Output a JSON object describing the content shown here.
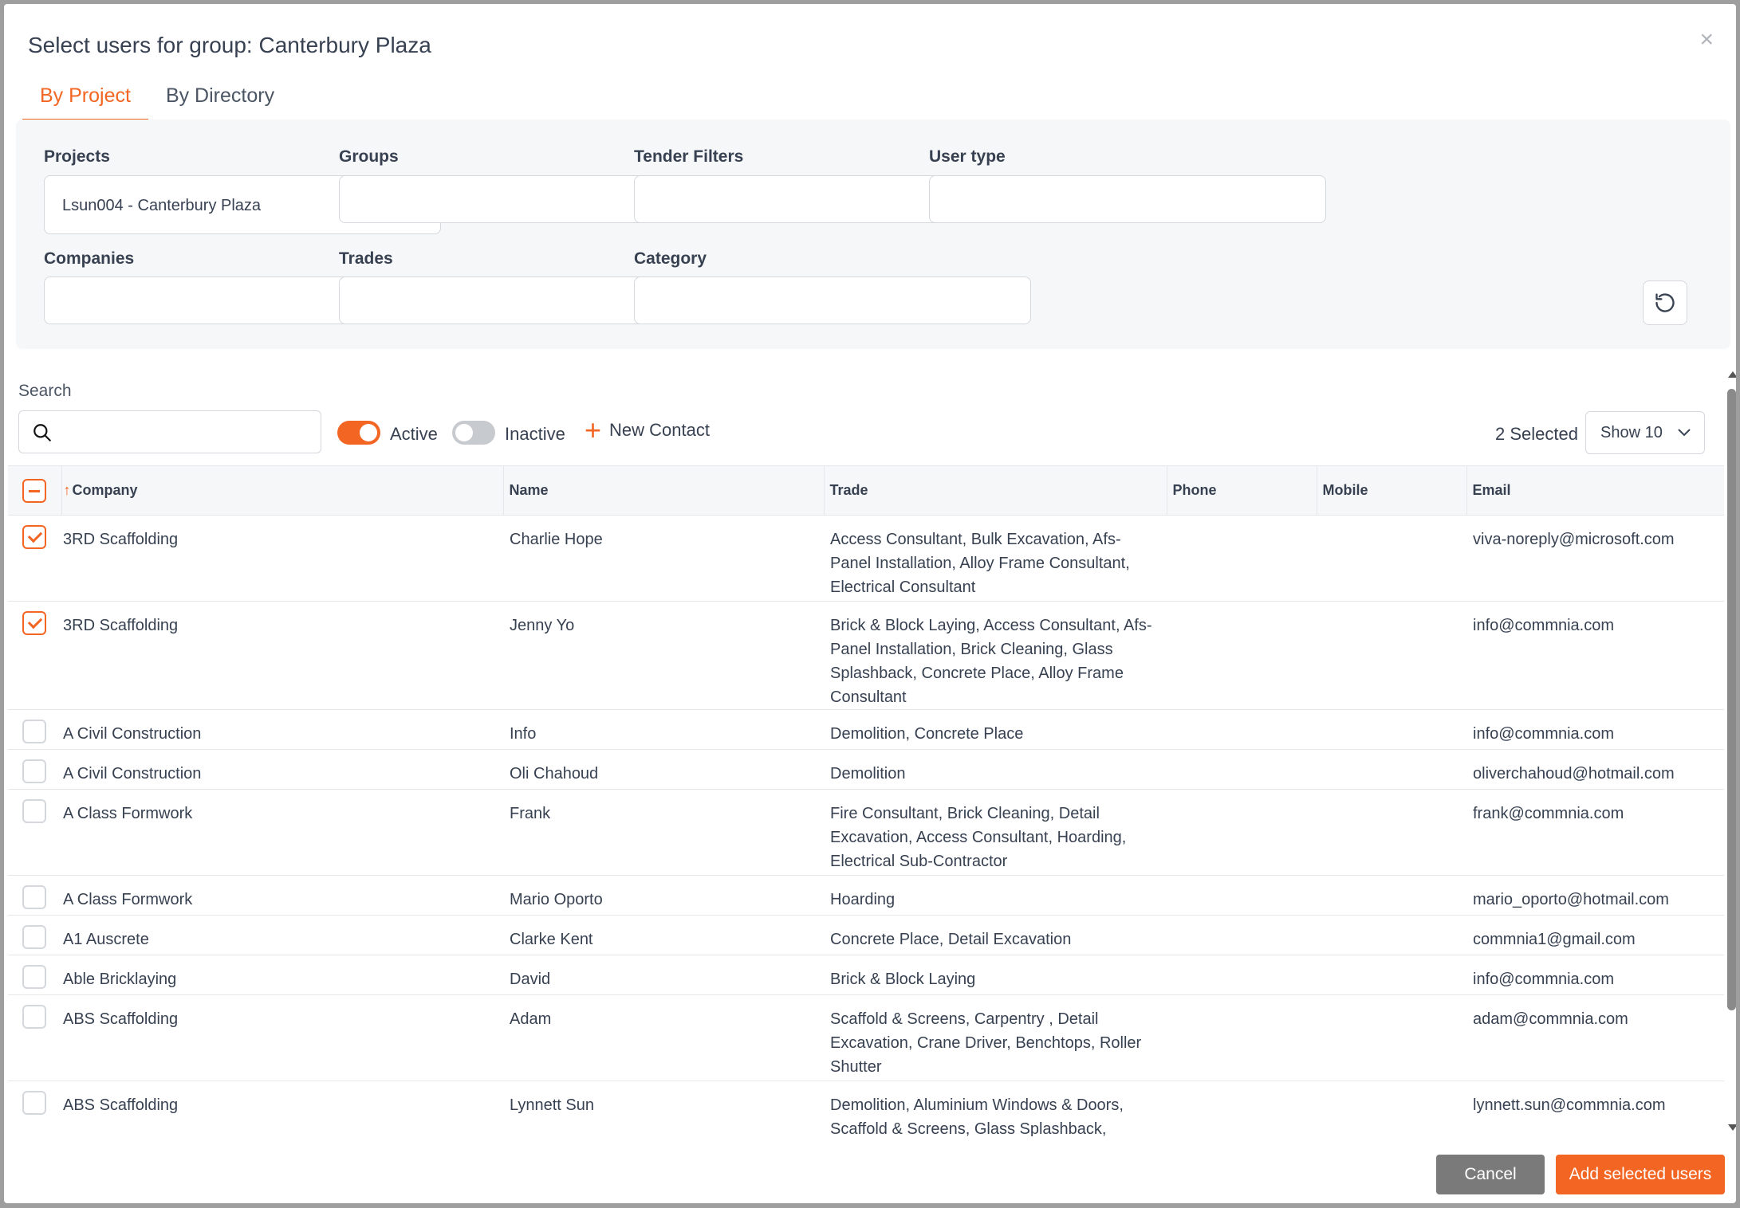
{
  "dialog": {
    "title": "Select users for group: Canterbury Plaza",
    "close_glyph": "×"
  },
  "tabs": [
    {
      "label": "By Project",
      "active": true
    },
    {
      "label": "By Directory",
      "active": false
    }
  ],
  "filters": {
    "projects": {
      "label": "Projects",
      "value": "Lsun004 - Canterbury Plaza"
    },
    "groups": {
      "label": "Groups",
      "value": ""
    },
    "tender_filters": {
      "label": "Tender Filters",
      "value": ""
    },
    "user_type": {
      "label": "User type",
      "value": ""
    },
    "companies": {
      "label": "Companies",
      "value": ""
    },
    "trades": {
      "label": "Trades",
      "value": ""
    },
    "category": {
      "label": "Category",
      "value": ""
    }
  },
  "toolbar": {
    "search_label": "Search",
    "search_value": "",
    "active_label": "Active",
    "active_on": true,
    "inactive_label": "Inactive",
    "inactive_on": false,
    "new_contact_label": "New Contact",
    "selected_count": "2 Selected",
    "show_value": "Show 10"
  },
  "table": {
    "columns": {
      "company": "Company",
      "name": "Name",
      "trade": "Trade",
      "phone": "Phone",
      "mobile": "Mobile",
      "email": "Email"
    },
    "sort_arrow": "↑",
    "rows": [
      {
        "checked": true,
        "company": "3RD Scaffolding",
        "name": "Charlie Hope",
        "trade": "Access Consultant, Bulk Excavation, Afs-Panel Installation, Alloy Frame Consultant, Electrical Consultant",
        "phone": "",
        "mobile": "",
        "email": "viva-noreply@microsoft.com"
      },
      {
        "checked": true,
        "company": "3RD Scaffolding",
        "name": "Jenny Yo",
        "trade": "Brick & Block Laying, Access Consultant, Afs-Panel Installation, Brick Cleaning, Glass Splashback, Concrete Place, Alloy Frame Consultant",
        "phone": "",
        "mobile": "",
        "email": "info@commnia.com"
      },
      {
        "checked": false,
        "company": "A Civil Construction",
        "name": "Info",
        "trade": "Demolition, Concrete Place",
        "phone": "",
        "mobile": "",
        "email": "info@commnia.com"
      },
      {
        "checked": false,
        "company": "A Civil Construction",
        "name": "Oli Chahoud",
        "trade": "Demolition",
        "phone": "",
        "mobile": "",
        "email": "oliverchahoud@hotmail.com"
      },
      {
        "checked": false,
        "company": "A Class Formwork",
        "name": "Frank",
        "trade": "Fire Consultant, Brick Cleaning, Detail Excavation, Access Consultant, Hoarding, Electrical Sub-Contractor",
        "phone": "",
        "mobile": "",
        "email": "frank@commnia.com"
      },
      {
        "checked": false,
        "company": "A Class Formwork",
        "name": "Mario Oporto",
        "trade": "Hoarding",
        "phone": "",
        "mobile": "",
        "email": "mario_oporto@hotmail.com"
      },
      {
        "checked": false,
        "company": "A1 Auscrete",
        "name": "Clarke Kent",
        "trade": "Concrete Place, Detail Excavation",
        "phone": "",
        "mobile": "",
        "email": "commnia1@gmail.com"
      },
      {
        "checked": false,
        "company": "Able Bricklaying",
        "name": "David",
        "trade": "Brick & Block Laying",
        "phone": "",
        "mobile": "",
        "email": "info@commnia.com"
      },
      {
        "checked": false,
        "company": "ABS Scaffolding",
        "name": "Adam",
        "trade": "Scaffold & Screens, Carpentry , Detail Excavation, Crane Driver, Benchtops, Roller Shutter",
        "phone": "",
        "mobile": "",
        "email": "adam@commnia.com"
      },
      {
        "checked": false,
        "company": "ABS Scaffolding",
        "name": "Lynnett Sun",
        "trade": "Demolition, Aluminium Windows & Doors, Scaffold & Screens, Glass Splashback, Electrical, Line Worker, Brick & Block Laying",
        "phone": "",
        "mobile": "",
        "email": "lynnett.sun@commnia.com"
      }
    ]
  },
  "footer": {
    "cancel_label": "Cancel",
    "add_label": "Add selected users"
  },
  "colors": {
    "accent": "#f26522",
    "cancel_bg": "#7a7a7a"
  }
}
